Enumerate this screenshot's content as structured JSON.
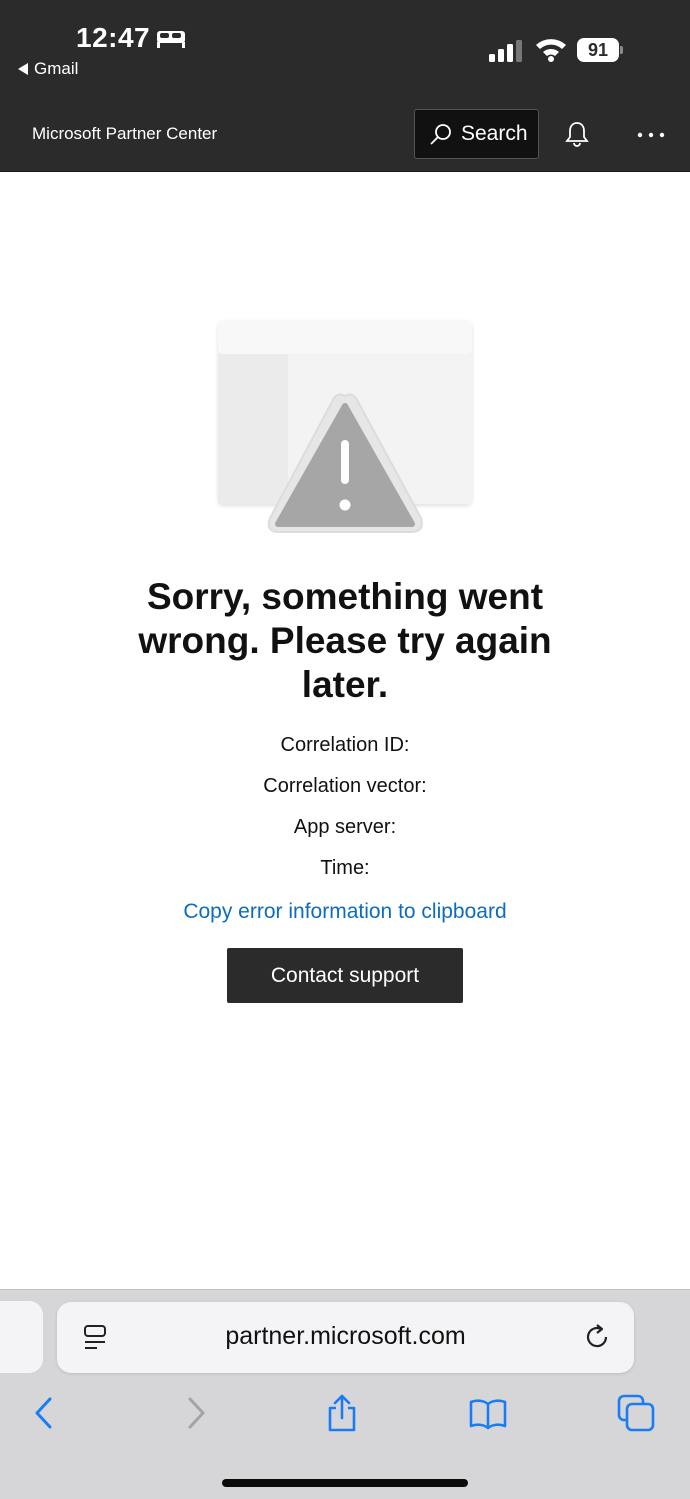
{
  "status_bar": {
    "time": "12:47",
    "back_app": "Gmail",
    "battery": "91"
  },
  "header": {
    "title": "Microsoft Partner Center",
    "search_label": "Search"
  },
  "error": {
    "title": "Sorry, something went wrong. Please try again later.",
    "correlation_id_label": "Correlation ID:",
    "correlation_vector_label": "Correlation vector:",
    "app_server_label": "App server:",
    "time_label": "Time:",
    "copy_link": "Copy error information to clipboard",
    "contact_button": "Contact support"
  },
  "browser": {
    "url": "partner.microsoft.com"
  },
  "colors": {
    "header_bg": "#2b2b2b",
    "link": "#0f6cbd",
    "ios_blue": "#1a7cf5"
  }
}
